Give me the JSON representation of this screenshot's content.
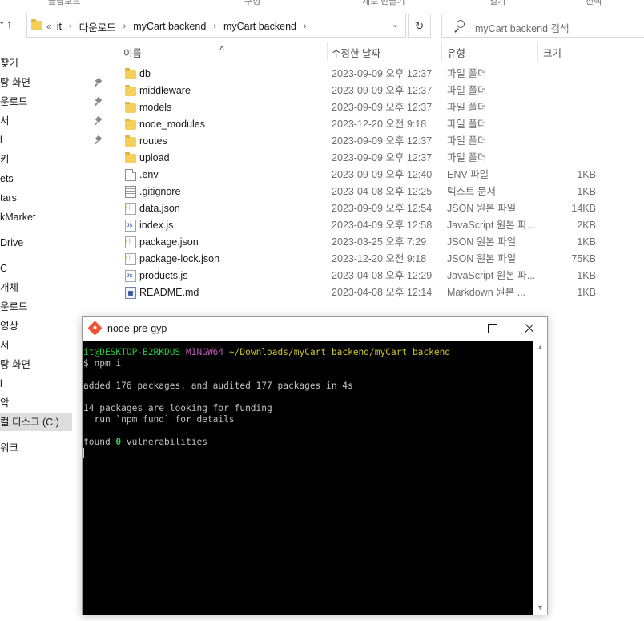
{
  "ribbon": {
    "fragments": [
      "클립보드",
      "구성",
      "새로 만들기",
      "열기",
      "선택"
    ]
  },
  "address_bar": {
    "lead": "«",
    "crumbs": [
      "it",
      "다운로드",
      "myCart backend",
      "myCart backend"
    ],
    "dropdown_glyph": "⌄",
    "refresh_glyph": "↻",
    "search_placeholder": "myCart backend 검색"
  },
  "nav_pane": {
    "items": [
      {
        "label": "찾기",
        "pinned": false
      },
      {
        "label": "탕 화면",
        "pinned": true
      },
      {
        "label": "운로드",
        "pinned": true
      },
      {
        "label": "서",
        "pinned": true
      },
      {
        "label": "l",
        "pinned": true
      },
      {
        "label": "키",
        "pinned": false
      },
      {
        "label": "ets",
        "pinned": false
      },
      {
        "label": "tars",
        "pinned": false
      },
      {
        "label": "kMarket",
        "pinned": false
      },
      {
        "label": "Drive",
        "pinned": false
      },
      {
        "label": "C",
        "pinned": false
      },
      {
        "label": "개체",
        "pinned": false
      },
      {
        "label": "운로드",
        "pinned": false
      },
      {
        "label": "영상",
        "pinned": false
      },
      {
        "label": "서",
        "pinned": false
      },
      {
        "label": "탕 화면",
        "pinned": false
      },
      {
        "label": "l",
        "pinned": false
      },
      {
        "label": "악",
        "pinned": false
      },
      {
        "label": "컬 디스크 (C:)",
        "pinned": false,
        "selected": true
      },
      {
        "label": "워크",
        "pinned": false
      }
    ]
  },
  "columns": {
    "name": "이름",
    "date": "수정한 날짜",
    "type": "유형",
    "size": "크기"
  },
  "files": [
    {
      "name": "db",
      "date": "2023-09-09 오후 12:37",
      "type": "파일 폴더",
      "size": "",
      "icon": "folder-icon"
    },
    {
      "name": "middleware",
      "date": "2023-09-09 오후 12:37",
      "type": "파일 폴더",
      "size": "",
      "icon": "folder-icon"
    },
    {
      "name": "models",
      "date": "2023-09-09 오후 12:37",
      "type": "파일 폴더",
      "size": "",
      "icon": "folder-icon"
    },
    {
      "name": "node_modules",
      "date": "2023-12-20 오전 9:18",
      "type": "파일 폴더",
      "size": "",
      "icon": "folder-icon"
    },
    {
      "name": "routes",
      "date": "2023-09-09 오후 12:37",
      "type": "파일 폴더",
      "size": "",
      "icon": "folder-icon"
    },
    {
      "name": "upload",
      "date": "2023-09-09 오후 12:37",
      "type": "파일 폴더",
      "size": "",
      "icon": "folder-icon"
    },
    {
      "name": ".env",
      "date": "2023-09-09 오후 12:40",
      "type": "ENV 파일",
      "size": "1KB",
      "icon": "file-icon"
    },
    {
      "name": ".gitignore",
      "date": "2023-04-08 오후 12:25",
      "type": "텍스트 문서",
      "size": "1KB",
      "icon": "text-file-icon"
    },
    {
      "name": "data.json",
      "date": "2023-09-09 오후 12:54",
      "type": "JSON 원본 파일",
      "size": "14KB",
      "icon": "json-file-icon"
    },
    {
      "name": "index.js",
      "date": "2023-04-09 오후 12:58",
      "type": "JavaScript 원본 파...",
      "size": "2KB",
      "icon": "js-file-icon"
    },
    {
      "name": "package.json",
      "date": "2023-03-25 오후 7:29",
      "type": "JSON 원본 파일",
      "size": "1KB",
      "icon": "json-file-icon"
    },
    {
      "name": "package-lock.json",
      "date": "2023-12-20 오전 9:18",
      "type": "JSON 원본 파일",
      "size": "75KB",
      "icon": "json-file-icon"
    },
    {
      "name": "products.js",
      "date": "2023-04-08 오후 12:29",
      "type": "JavaScript 원본 파...",
      "size": "1KB",
      "icon": "js-file-icon"
    },
    {
      "name": "README.md",
      "date": "2023-04-08 오후 12:14",
      "type": "Markdown 원본 ...",
      "size": "1KB",
      "icon": "markdown-file-icon"
    }
  ],
  "terminal": {
    "title": "node-pre-gyp",
    "prompt_user": "it@DESKTOP-B2RKDUS",
    "prompt_env": "MINGW64",
    "prompt_path": "~/Downloads/myCart backend/myCart backend",
    "command": "$ npm i",
    "added_line": "added 176 packages, and audited 177 packages in 4s",
    "funding_line_1": "14 packages are looking for funding",
    "funding_line_2": "  run `npm fund` for details",
    "found_prefix": "found ",
    "found_count": "0",
    "found_suffix": " vulnerabilities"
  }
}
